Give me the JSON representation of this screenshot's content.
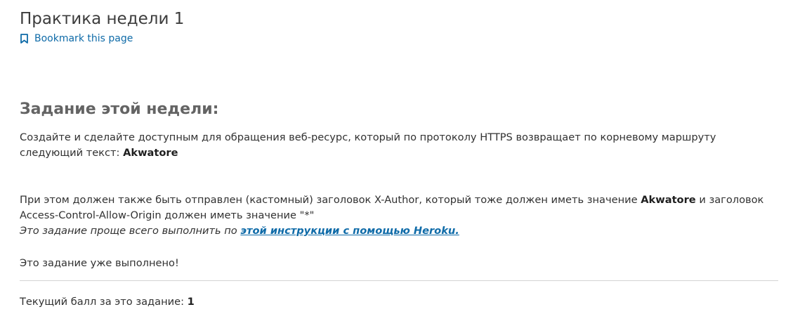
{
  "page": {
    "title": "Практика недели 1",
    "bookmark_label": "Bookmark this page"
  },
  "task": {
    "heading": "Задание этой недели:",
    "line1_part1": "Создайте и сделайте доступным для обращения веб-ресурс, который по протоколу HTTPS возвращает по корневому маршруту",
    "line1_part2": "следующий текст: ",
    "value": "Akwatore",
    "line2_part1": "При этом должен также быть отправлен (кастомный) заголовок X-Author, который тоже должен иметь значение ",
    "line2_value": "Akwatore",
    "line2_part2": " и заголовок",
    "line2_part3": "Access-Control-Allow-Origin должен иметь значение \"*\"",
    "hint_prefix": "Это задание проще всего выполнить по ",
    "hint_link": "этой инструкции с помощью Heroku.",
    "status": "Это задание уже выполнено!"
  },
  "score": {
    "label": "Текущий балл за это задание: ",
    "value": "1"
  },
  "colors": {
    "link": "#0f6ba8",
    "heading": "#646464",
    "text": "#313131",
    "divider": "#d3d3d3"
  },
  "icons": {
    "bookmark": "bookmark-icon"
  }
}
